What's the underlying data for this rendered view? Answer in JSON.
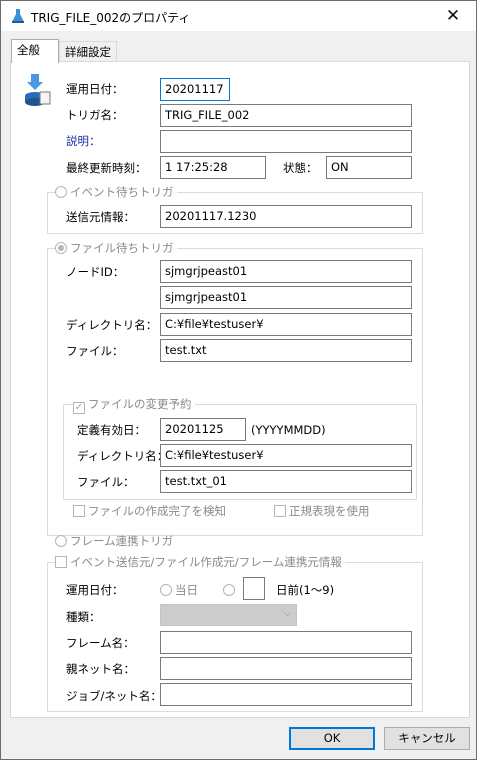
{
  "window": {
    "title": "TRIG_FILE_002のプロパティ",
    "close_glyph": "✕"
  },
  "tabs": [
    {
      "label": "全般"
    },
    {
      "label": "詳細設定"
    }
  ],
  "general": {
    "operation_date": {
      "label": "運用日付：",
      "value": "20201117"
    },
    "trigger_name": {
      "label": "トリガ名：",
      "value": "TRIG_FILE_002"
    },
    "description": {
      "label": "説明：",
      "value": ""
    },
    "last_updated": {
      "label": "最終更新時刻：",
      "value": "1 17:25:28"
    },
    "state": {
      "label": "状態：",
      "value": "ON"
    }
  },
  "event_trigger": {
    "title": "イベント待ちトリガ",
    "sender_info": {
      "label": "送信元情報：",
      "value": "20201117.1230"
    }
  },
  "file_trigger": {
    "title": "ファイル待ちトリガ",
    "node_id": {
      "label": "ノードID：",
      "value1": "sjmgrjpeast01",
      "value2": "sjmgrjpeast01"
    },
    "directory": {
      "label": "ディレクトリ名：",
      "value": "C:¥file¥testuser¥"
    },
    "file": {
      "label": "ファイル：",
      "value": "test.txt"
    },
    "change_reservation": {
      "title": "ファイルの変更予約",
      "effective_date": {
        "label": "定義有効日：",
        "value": "20201125",
        "hint": "(YYYYMMDD)"
      },
      "directory": {
        "label": "ディレクトリ名：",
        "value": "C:¥file¥testuser¥"
      },
      "file": {
        "label": "ファイル：",
        "value": "test.txt_01"
      }
    },
    "detect_complete": "ファイルの作成完了を検知",
    "use_regex": "正規表現を使用"
  },
  "frame_trigger": {
    "title": "フレーム連携トリガ"
  },
  "event_source": {
    "title": "イベント送信元/ファイル作成元/フレーム連携元情報",
    "operation_date": {
      "label": "運用日付：",
      "today": "当日",
      "days_before_value": "",
      "days_before": "日前(1〜9)"
    },
    "type": {
      "label": "種類：",
      "value": ""
    },
    "frame_name": {
      "label": "フレーム名：",
      "value": ""
    },
    "parent_net": {
      "label": "親ネット名：",
      "value": ""
    },
    "job_net": {
      "label": "ジョブ/ネット名：",
      "value": ""
    }
  },
  "buttons": {
    "ok": "OK",
    "cancel": "キャンセル"
  }
}
